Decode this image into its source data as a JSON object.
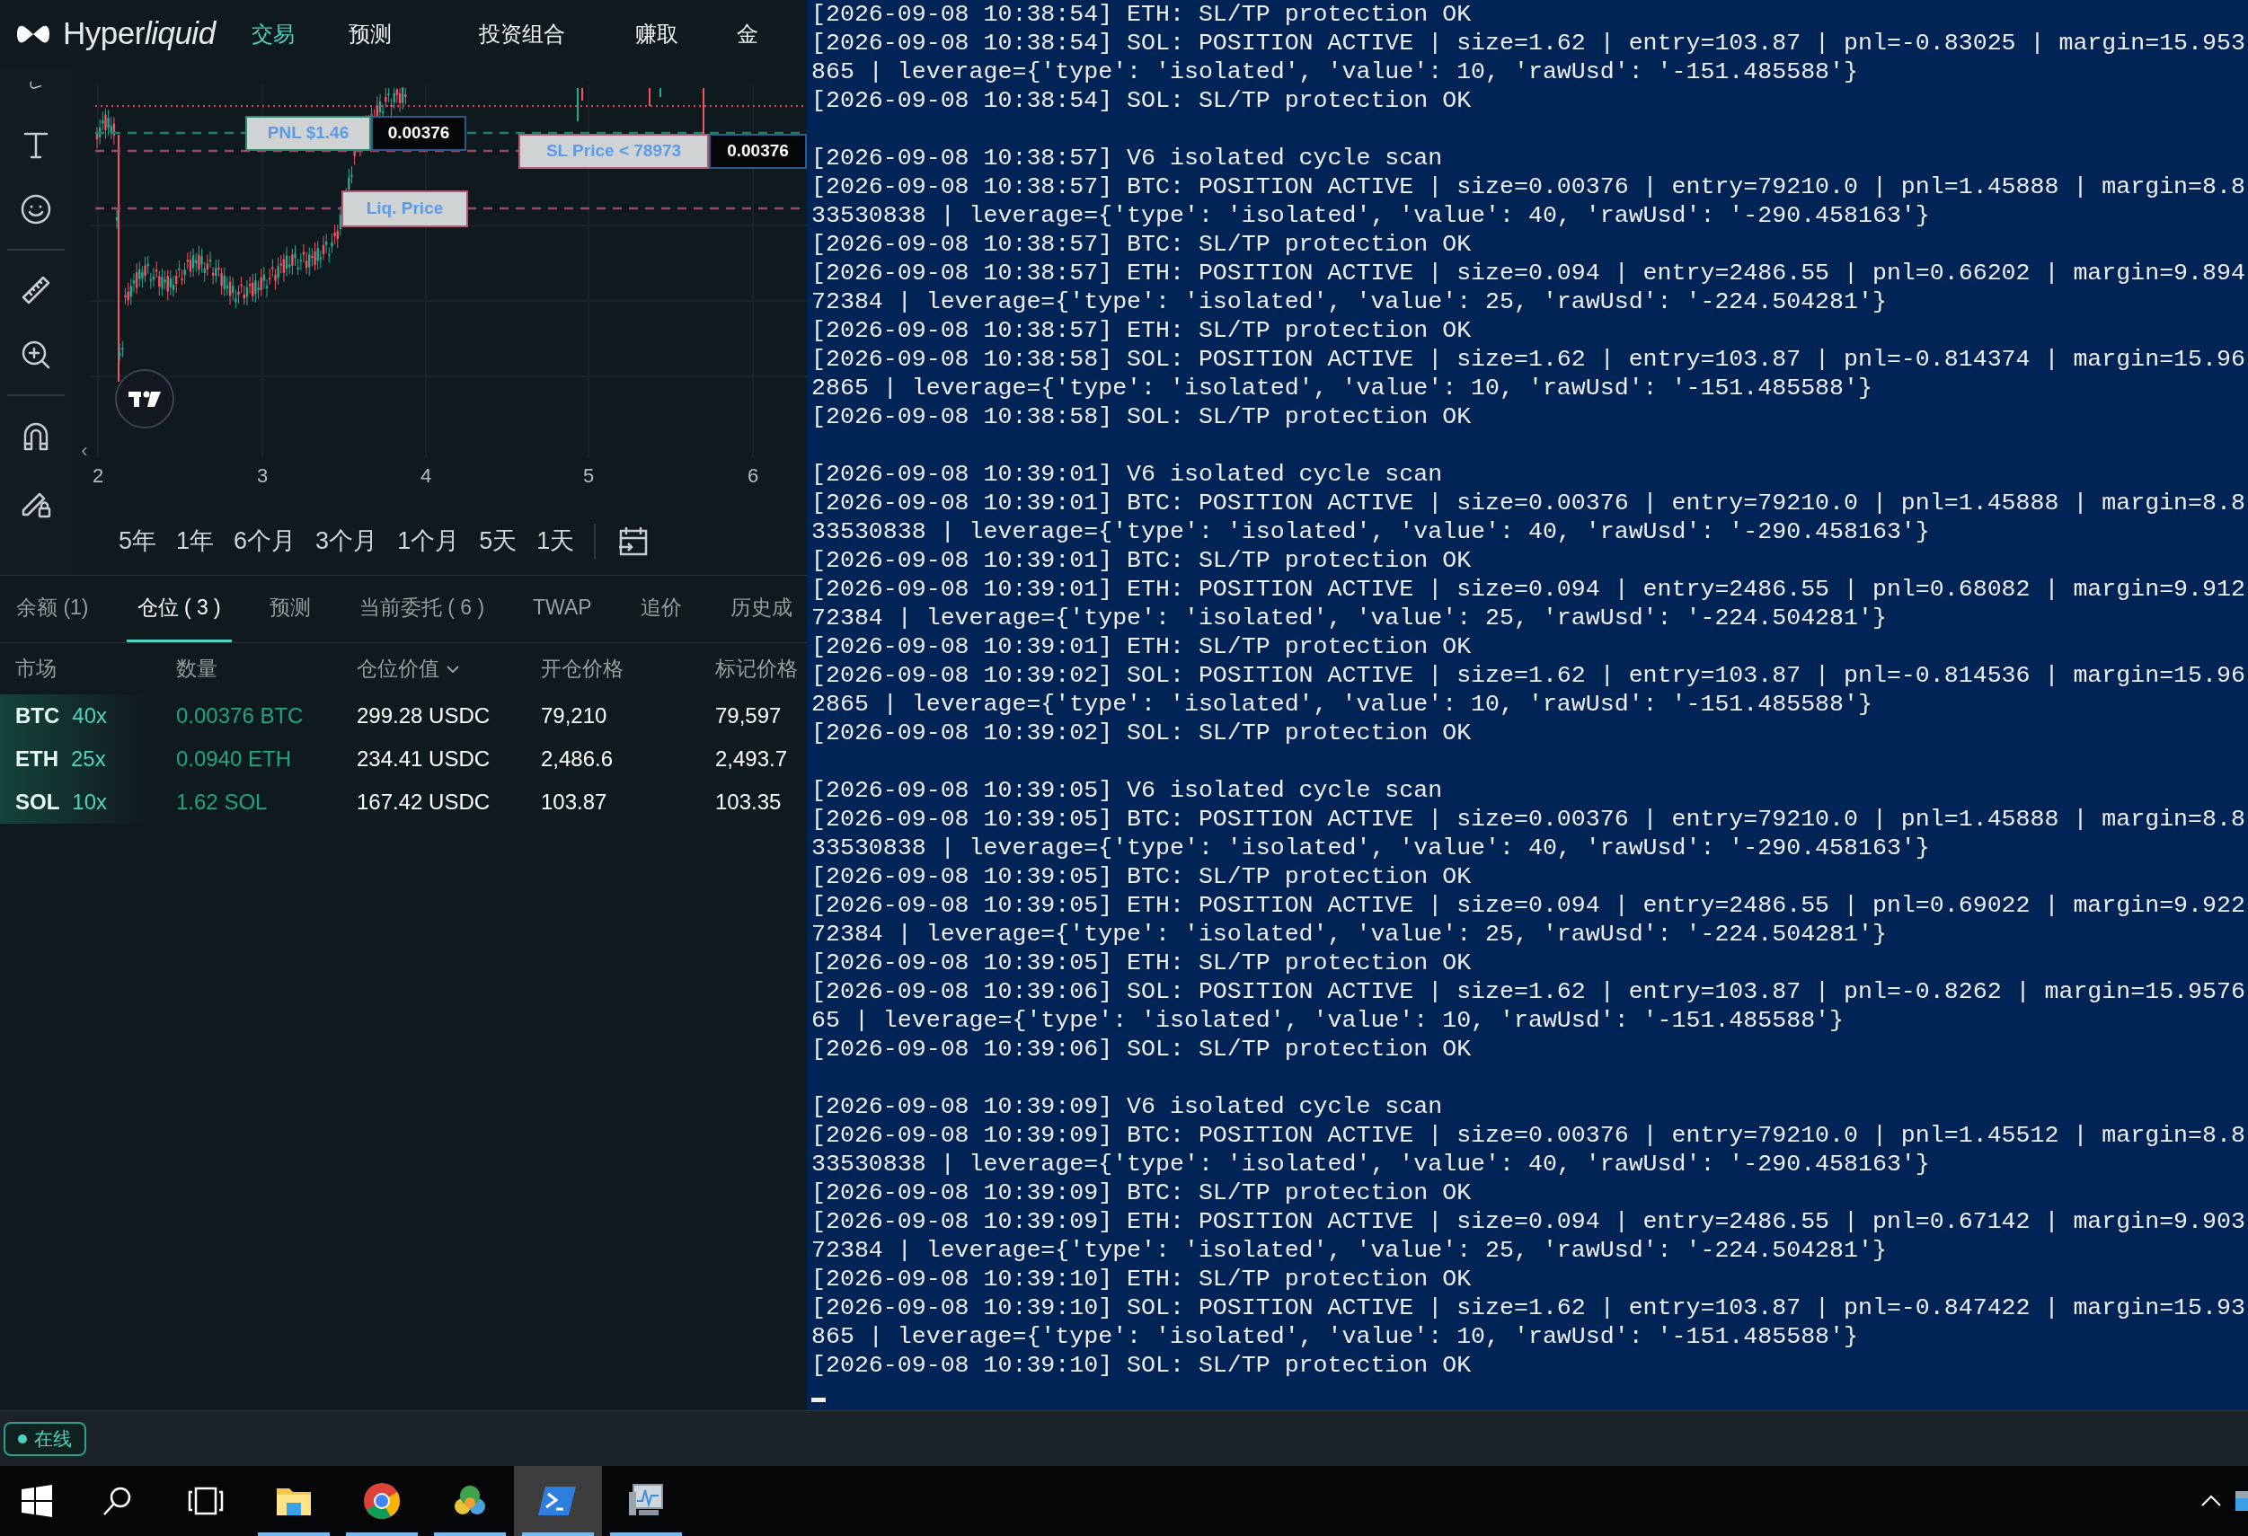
{
  "header": {
    "logo": {
      "regular": "Hyper",
      "italic": "liquid"
    },
    "nav": [
      {
        "label": "交易",
        "selected": true
      },
      {
        "label": "预测",
        "selected": false
      },
      {
        "label": "投资组合",
        "selected": false
      },
      {
        "label": "赚取",
        "selected": false
      },
      {
        "label": "金",
        "selected": false
      }
    ]
  },
  "chart": {
    "x_labels": [
      "2",
      "3",
      "4",
      "5",
      "6"
    ],
    "pnl_label": "PNL $1.46",
    "pnl_size": "0.00376",
    "sl_label": "SL Price < 78973",
    "sl_size": "0.00376",
    "liq_label": "Liq. Price",
    "collapse_glyph": "‹",
    "ranges": [
      "5年",
      "1年",
      "6个月",
      "3个月",
      "1个月",
      "5天",
      "1天"
    ]
  },
  "tabs": [
    {
      "label": "余额 (1)",
      "selected": false
    },
    {
      "label": "仓位 ( 3 )",
      "selected": true
    },
    {
      "label": "预测",
      "selected": false
    },
    {
      "label": "当前委托 ( 6 )",
      "selected": false
    },
    {
      "label": "TWAP",
      "selected": false
    },
    {
      "label": "追价",
      "selected": false
    },
    {
      "label": "历史成",
      "selected": false
    }
  ],
  "positions": {
    "columns": [
      {
        "label": "市场",
        "sorted": false
      },
      {
        "label": "数量",
        "sorted": false
      },
      {
        "label": "仓位价值",
        "sorted": true
      },
      {
        "label": "开仓价格",
        "sorted": false
      },
      {
        "label": "标记价格",
        "sorted": false
      }
    ],
    "rows": [
      {
        "coin": "BTC",
        "leverage": "40x",
        "size": "0.00376 BTC",
        "value": "299.28 USDC",
        "entry": "79,210",
        "mark": "79,597"
      },
      {
        "coin": "ETH",
        "leverage": "25x",
        "size": "0.0940 ETH",
        "value": "234.41 USDC",
        "entry": "2,486.6",
        "mark": "2,493.7"
      },
      {
        "coin": "SOL",
        "leverage": "10x",
        "size": "1.62 SOL",
        "value": "167.42 USDC",
        "entry": "103.87",
        "mark": "103.35"
      }
    ]
  },
  "terminal": {
    "groups": [
      [
        "[2026-09-08 10:38:54] ETH: SL/TP protection OK",
        "[2026-09-08 10:38:54] SOL: POSITION ACTIVE | size=1.62 | entry=103.87 | pnl=-0.83025 | margin=15.953865 | leverage={'type': 'isolated', 'value': 10, 'rawUsd': '-151.485588'}",
        "[2026-09-08 10:38:54] SOL: SL/TP protection OK"
      ],
      [
        "[2026-09-08 10:38:57] V6 isolated cycle scan",
        "[2026-09-08 10:38:57] BTC: POSITION ACTIVE | size=0.00376 | entry=79210.0 | pnl=1.45888 | margin=8.833530838 | leverage={'type': 'isolated', 'value': 40, 'rawUsd': '-290.458163'}",
        "[2026-09-08 10:38:57] BTC: SL/TP protection OK",
        "[2026-09-08 10:38:57] ETH: POSITION ACTIVE | size=0.094 | entry=2486.55 | pnl=0.66202 | margin=9.89472384 | leverage={'type': 'isolated', 'value': 25, 'rawUsd': '-224.504281'}",
        "[2026-09-08 10:38:57] ETH: SL/TP protection OK",
        "[2026-09-08 10:38:58] SOL: POSITION ACTIVE | size=1.62 | entry=103.87 | pnl=-0.814374 | margin=15.962865 | leverage={'type': 'isolated', 'value': 10, 'rawUsd': '-151.485588'}",
        "[2026-09-08 10:38:58] SOL: SL/TP protection OK"
      ],
      [
        "[2026-09-08 10:39:01] V6 isolated cycle scan",
        "[2026-09-08 10:39:01] BTC: POSITION ACTIVE | size=0.00376 | entry=79210.0 | pnl=1.45888 | margin=8.833530838 | leverage={'type': 'isolated', 'value': 40, 'rawUsd': '-290.458163'}",
        "[2026-09-08 10:39:01] BTC: SL/TP protection OK",
        "[2026-09-08 10:39:01] ETH: POSITION ACTIVE | size=0.094 | entry=2486.55 | pnl=0.68082 | margin=9.91272384 | leverage={'type': 'isolated', 'value': 25, 'rawUsd': '-224.504281'}",
        "[2026-09-08 10:39:01] ETH: SL/TP protection OK",
        "[2026-09-08 10:39:02] SOL: POSITION ACTIVE | size=1.62 | entry=103.87 | pnl=-0.814536 | margin=15.962865 | leverage={'type': 'isolated', 'value': 10, 'rawUsd': '-151.485588'}",
        "[2026-09-08 10:39:02] SOL: SL/TP protection OK"
      ],
      [
        "[2026-09-08 10:39:05] V6 isolated cycle scan",
        "[2026-09-08 10:39:05] BTC: POSITION ACTIVE | size=0.00376 | entry=79210.0 | pnl=1.45888 | margin=8.833530838 | leverage={'type': 'isolated', 'value': 40, 'rawUsd': '-290.458163'}",
        "[2026-09-08 10:39:05] BTC: SL/TP protection OK",
        "[2026-09-08 10:39:05] ETH: POSITION ACTIVE | size=0.094 | entry=2486.55 | pnl=0.69022 | margin=9.92272384 | leverage={'type': 'isolated', 'value': 25, 'rawUsd': '-224.504281'}",
        "[2026-09-08 10:39:05] ETH: SL/TP protection OK",
        "[2026-09-08 10:39:06] SOL: POSITION ACTIVE | size=1.62 | entry=103.87 | pnl=-0.8262 | margin=15.957665 | leverage={'type': 'isolated', 'value': 10, 'rawUsd': '-151.485588'}",
        "[2026-09-08 10:39:06] SOL: SL/TP protection OK"
      ],
      [
        "[2026-09-08 10:39:09] V6 isolated cycle scan",
        "[2026-09-08 10:39:09] BTC: POSITION ACTIVE | size=0.00376 | entry=79210.0 | pnl=1.45512 | margin=8.833530838 | leverage={'type': 'isolated', 'value': 40, 'rawUsd': '-290.458163'}",
        "[2026-09-08 10:39:09] BTC: SL/TP protection OK",
        "[2026-09-08 10:39:09] ETH: POSITION ACTIVE | size=0.094 | entry=2486.55 | pnl=0.67142 | margin=9.90372384 | leverage={'type': 'isolated', 'value': 25, 'rawUsd': '-224.504281'}",
        "[2026-09-08 10:39:10] ETH: SL/TP protection OK",
        "[2026-09-08 10:39:10] SOL: POSITION ACTIVE | size=1.62 | entry=103.87 | pnl=-0.847422 | margin=15.93865 | leverage={'type': 'isolated', 'value': 10, 'rawUsd': '-151.485588'}",
        "[2026-09-08 10:39:10] SOL: SL/TP protection OK"
      ]
    ]
  },
  "status": {
    "label": "在线"
  },
  "taskbar": {
    "apps": [
      {
        "kind": "folder",
        "running": true,
        "active": false
      },
      {
        "kind": "round",
        "running": true,
        "active": false
      },
      {
        "kind": "trading",
        "running": true,
        "active": false
      },
      {
        "kind": "shell",
        "running": true,
        "active": true
      },
      {
        "kind": "monitor",
        "running": true,
        "active": false
      }
    ]
  }
}
